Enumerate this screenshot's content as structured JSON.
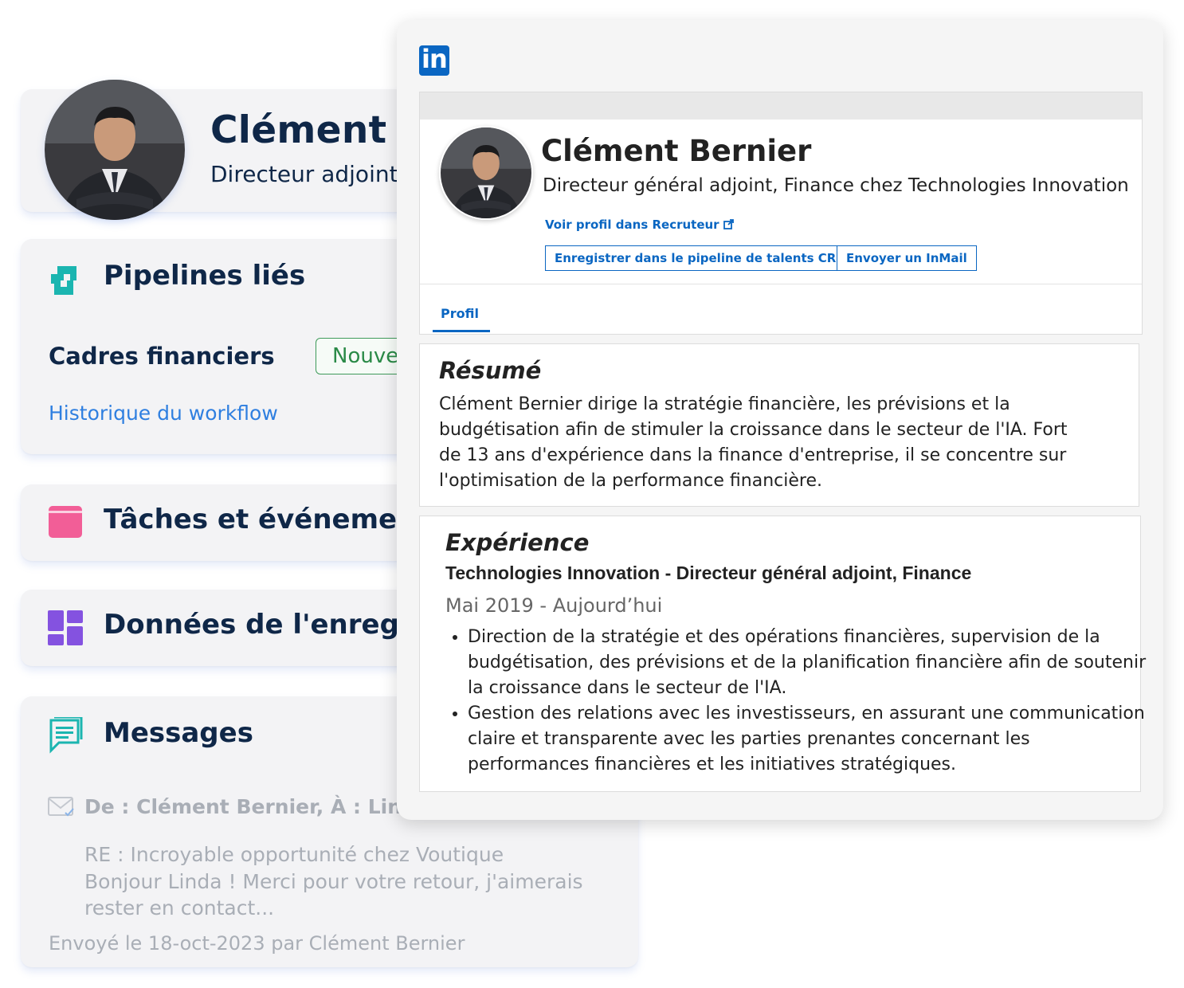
{
  "profile": {
    "name": "Clément Bernier",
    "title_truncated": "Directeur adjoint"
  },
  "pipelines": {
    "title": "Pipelines liés",
    "pipeline_name": "Cadres financiers",
    "status_badge": "Nouveau",
    "workflow_link": "Historique du workflow"
  },
  "tasks": {
    "title": "Tâches et événements"
  },
  "record": {
    "title": "Données de l'enregistrement"
  },
  "messages": {
    "title": "Messages",
    "from": "De : Clément Bernier, À : Linda M",
    "subject": "RE : Incroyable opportunité chez Voutique",
    "body": "Bonjour Linda ! Merci pour votre retour, j'aimerais rester en contact...",
    "sent": "Envoyé le 18-oct-2023 par Clément Bernier"
  },
  "linkedin": {
    "logo_text": "in",
    "name": "Clément Bernier",
    "headline": "Directeur général adjoint, Finance chez Technologies Innovation",
    "view_link": "Voir profil dans Recruteur",
    "btn_save": "Enregistrer dans le pipeline de talents CRM",
    "btn_inmail": "Envoyer un InMail",
    "tab_profile": "Profil",
    "summary_title": "Résumé",
    "summary_text": "Clément Bernier dirige la stratégie financière, les prévisions et la budgétisation afin de stimuler la croissance dans le secteur de l'IA. Fort de 13 ans d'expérience dans la finance d'entreprise, il se concentre sur l'optimisation de la performance financière.",
    "experience_title": "Expérience",
    "exp_role": "Technologies Innovation - Directeur général adjoint, Finance",
    "exp_dates": "Mai 2019 - Aujourd’hui",
    "exp_bullets": [
      "Direction de la stratégie et des opérations financières, supervision de la budgétisation, des prévisions et de la planification financière afin de soutenir la croissance dans le secteur de l'IA.",
      "Gestion des relations avec les investisseurs, en assurant une communication claire et transparente avec les parties prenantes concernant les performances financières et les initiatives stratégiques."
    ]
  },
  "colors": {
    "navy": "#0f2748",
    "teal": "#1bb5b0",
    "pink": "#f25e97",
    "purple": "#8452e0",
    "linkedin_blue": "#0a66c2",
    "link_blue": "#2f7fe0"
  },
  "icons": [
    "pipeline-icon",
    "calendar-icon",
    "grid-icon",
    "message-icon",
    "mail-icon",
    "external-link-icon",
    "linkedin-logo"
  ]
}
